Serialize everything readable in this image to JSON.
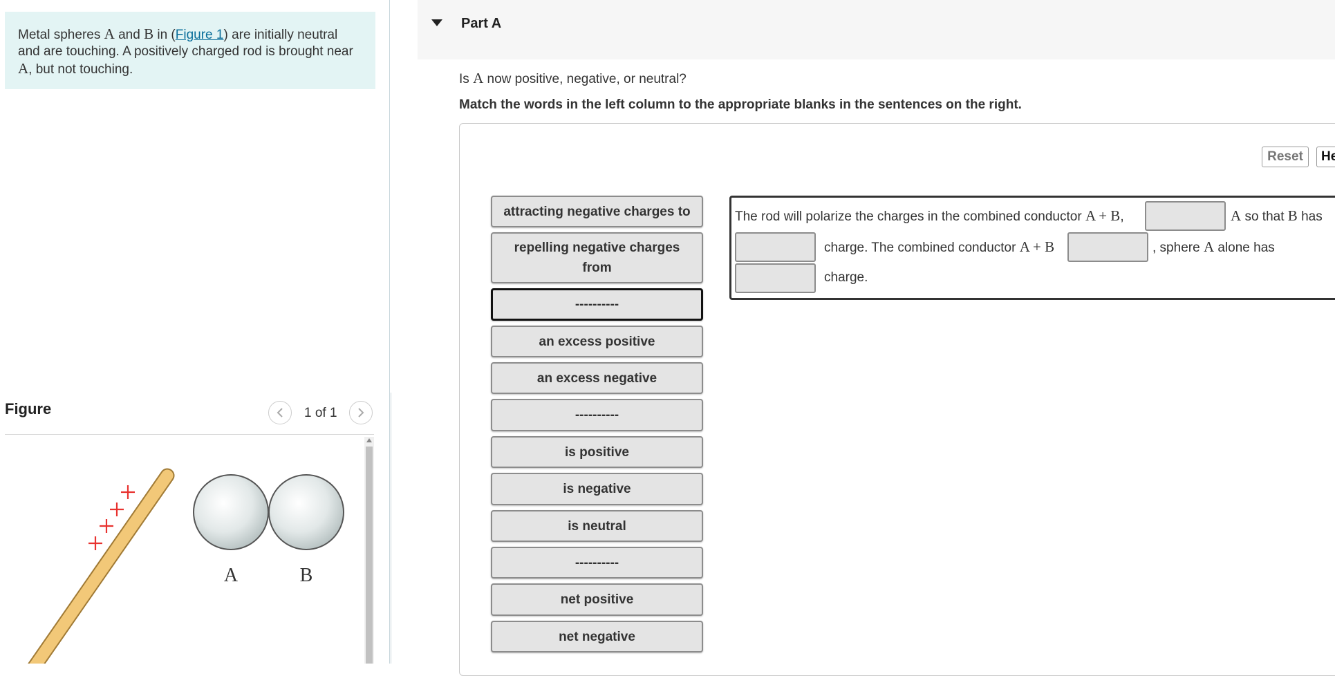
{
  "problem": {
    "text_1": "Metal spheres ",
    "var_a": "A",
    "text_2": " and ",
    "var_b": "B",
    "text_3": " in (",
    "figure_link": "Figure 1",
    "text_4": ") are initially neutral and are touching. A positively charged rod is brought near ",
    "var_a2": "A",
    "text_5": ", but not touching."
  },
  "figure": {
    "title": "Figure",
    "counter": "1 of 1",
    "prev_icon": "chevron-left-icon",
    "next_icon": "chevron-right-icon",
    "label_a": "A",
    "label_b": "B",
    "plus_signs": [
      "+",
      "+",
      "+",
      "+"
    ]
  },
  "part": {
    "title": "Part A",
    "question_1": "Is ",
    "question_var": "A",
    "question_2": " now positive, negative, or neutral?",
    "instruction": "Match the words in the left column to the appropriate blanks in the sentences on the right."
  },
  "toolbar": {
    "reset_label": "Reset",
    "help_label": "He"
  },
  "tiles": [
    "attracting negative charges to",
    "repelling negative charges from",
    "----------",
    "an excess positive",
    "an excess negative",
    "----------",
    "is positive",
    "is negative",
    "is neutral",
    "----------",
    "net positive",
    "net negative"
  ],
  "sentence": {
    "s1": "The rod will polarize the charges in the combined conductor ",
    "s1_math": "A + B",
    "s1_comma": ",",
    "s2_var": "A",
    "s2": " so that ",
    "s2_var_b": "B",
    "s2_end": " has",
    "s3": "charge. The combined conductor ",
    "s3_math": "A + B",
    "s4": ", sphere ",
    "s4_var": "A",
    "s4_end": " alone has",
    "s5": "charge."
  },
  "colors": {
    "problem_bg": "#e3f4f4",
    "link": "#0a6e9a",
    "tile_bg": "#e4e4e4",
    "plus": "#e8322f",
    "rod": "#f2c878"
  }
}
